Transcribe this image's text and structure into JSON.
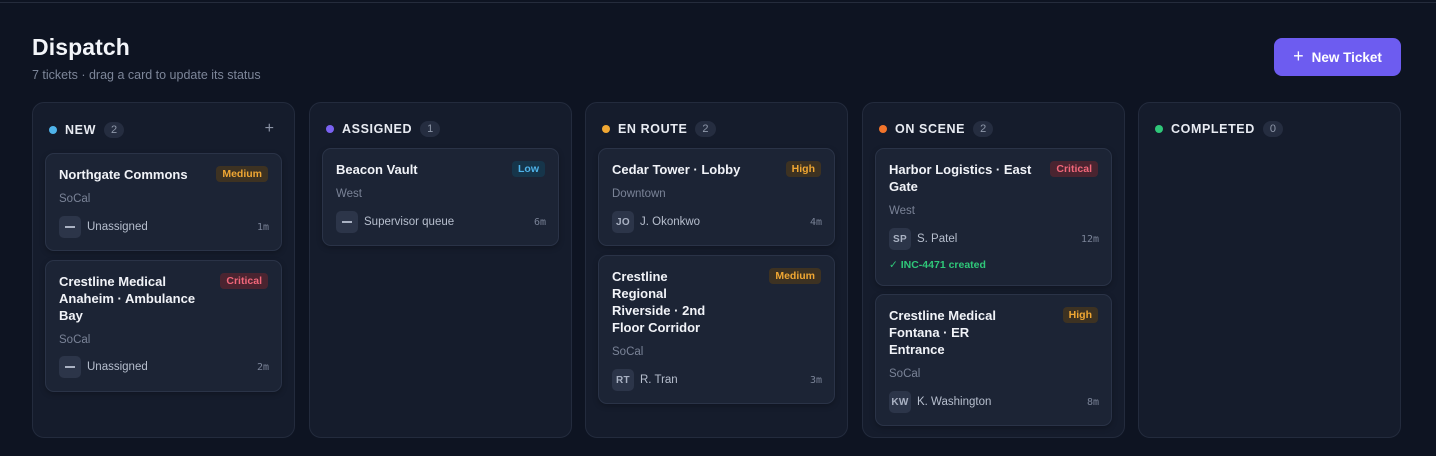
{
  "header": {
    "title": "Dispatch",
    "subtitle": "7 tickets · drag a card to update its status",
    "new_ticket_label": "New Ticket"
  },
  "columns": [
    {
      "title": "NEW",
      "count": "2",
      "color": "#4fb3ea",
      "add_label": "+",
      "cards": [
        {
          "title": "Northgate Commons",
          "priority": "Medium",
          "region": "SoCal",
          "avatar": "",
          "assignee": "Unassigned",
          "age": "1m"
        },
        {
          "title": "Crestline Medical Anaheim · Ambulance Bay",
          "priority": "Critical",
          "region": "SoCal",
          "avatar": "",
          "assignee": "Unassigned",
          "age": "2m"
        }
      ]
    },
    {
      "title": "ASSIGNED",
      "count": "1",
      "color": "#7a62f2",
      "cards": [
        {
          "title": "Beacon Vault",
          "priority": "Low",
          "region": "West",
          "avatar": "",
          "assignee": "Supervisor queue",
          "age": "6m"
        }
      ]
    },
    {
      "title": "EN ROUTE",
      "count": "2",
      "color": "#f0a733",
      "cards": [
        {
          "title": "Cedar Tower · Lobby",
          "priority": "High",
          "region": "Downtown",
          "avatar": "JO",
          "assignee": "J. Okonkwo",
          "age": "4m"
        },
        {
          "title": "Crestline Regional Riverside · 2nd Floor Corridor",
          "priority": "Medium",
          "region": "SoCal",
          "avatar": "RT",
          "assignee": "R. Tran",
          "age": "3m"
        }
      ]
    },
    {
      "title": "ON SCENE",
      "count": "2",
      "color": "#f2742b",
      "cards": [
        {
          "title": "Harbor Logistics · East Gate",
          "priority": "Critical",
          "region": "West",
          "avatar": "SP",
          "assignee": "S. Patel",
          "age": "12m",
          "incident": "✓ INC-4471 created"
        },
        {
          "title": "Crestline Medical Fontana · ER Entrance",
          "priority": "High",
          "region": "SoCal",
          "avatar": "KW",
          "assignee": "K. Washington",
          "age": "8m"
        }
      ]
    },
    {
      "title": "COMPLETED",
      "count": "0",
      "color": "#2fc779",
      "cards": []
    }
  ],
  "priority_colors": {
    "Low": "#4fb3ea",
    "Medium": "#f0a733",
    "High": "#f0a733",
    "Critical": "#f2677a"
  }
}
